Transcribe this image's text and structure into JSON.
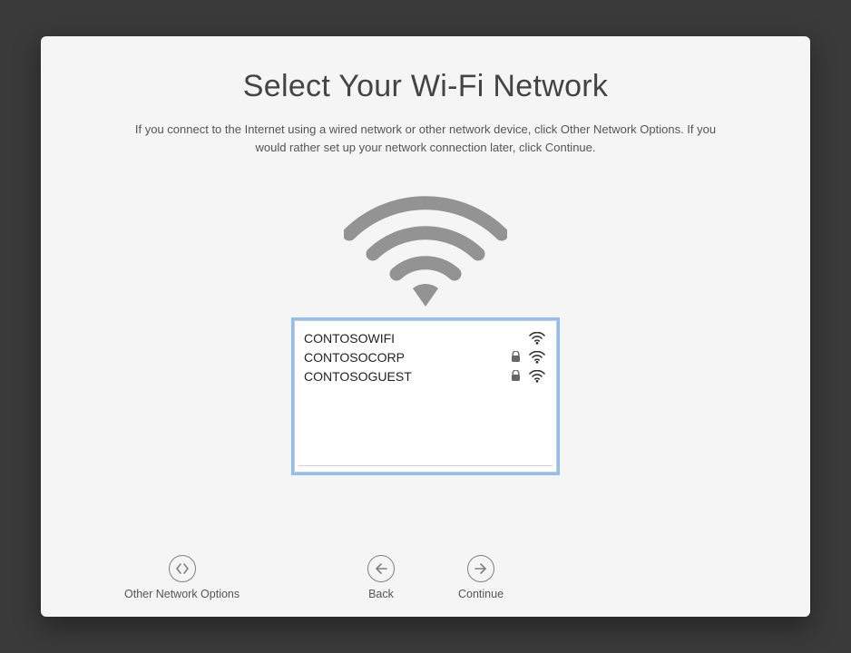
{
  "title": "Select Your Wi-Fi Network",
  "subtitle": "If you connect to the Internet using a wired network or other network device, click Other Network Options. If you would rather set up your network connection later, click Continue.",
  "networks": [
    {
      "name": "CONTOSOWIFI",
      "locked": false
    },
    {
      "name": "CONTOSOCORP",
      "locked": true
    },
    {
      "name": "CONTOSOGUEST",
      "locked": true
    }
  ],
  "buttons": {
    "other": "Other Network Options",
    "back": "Back",
    "continue": "Continue"
  }
}
